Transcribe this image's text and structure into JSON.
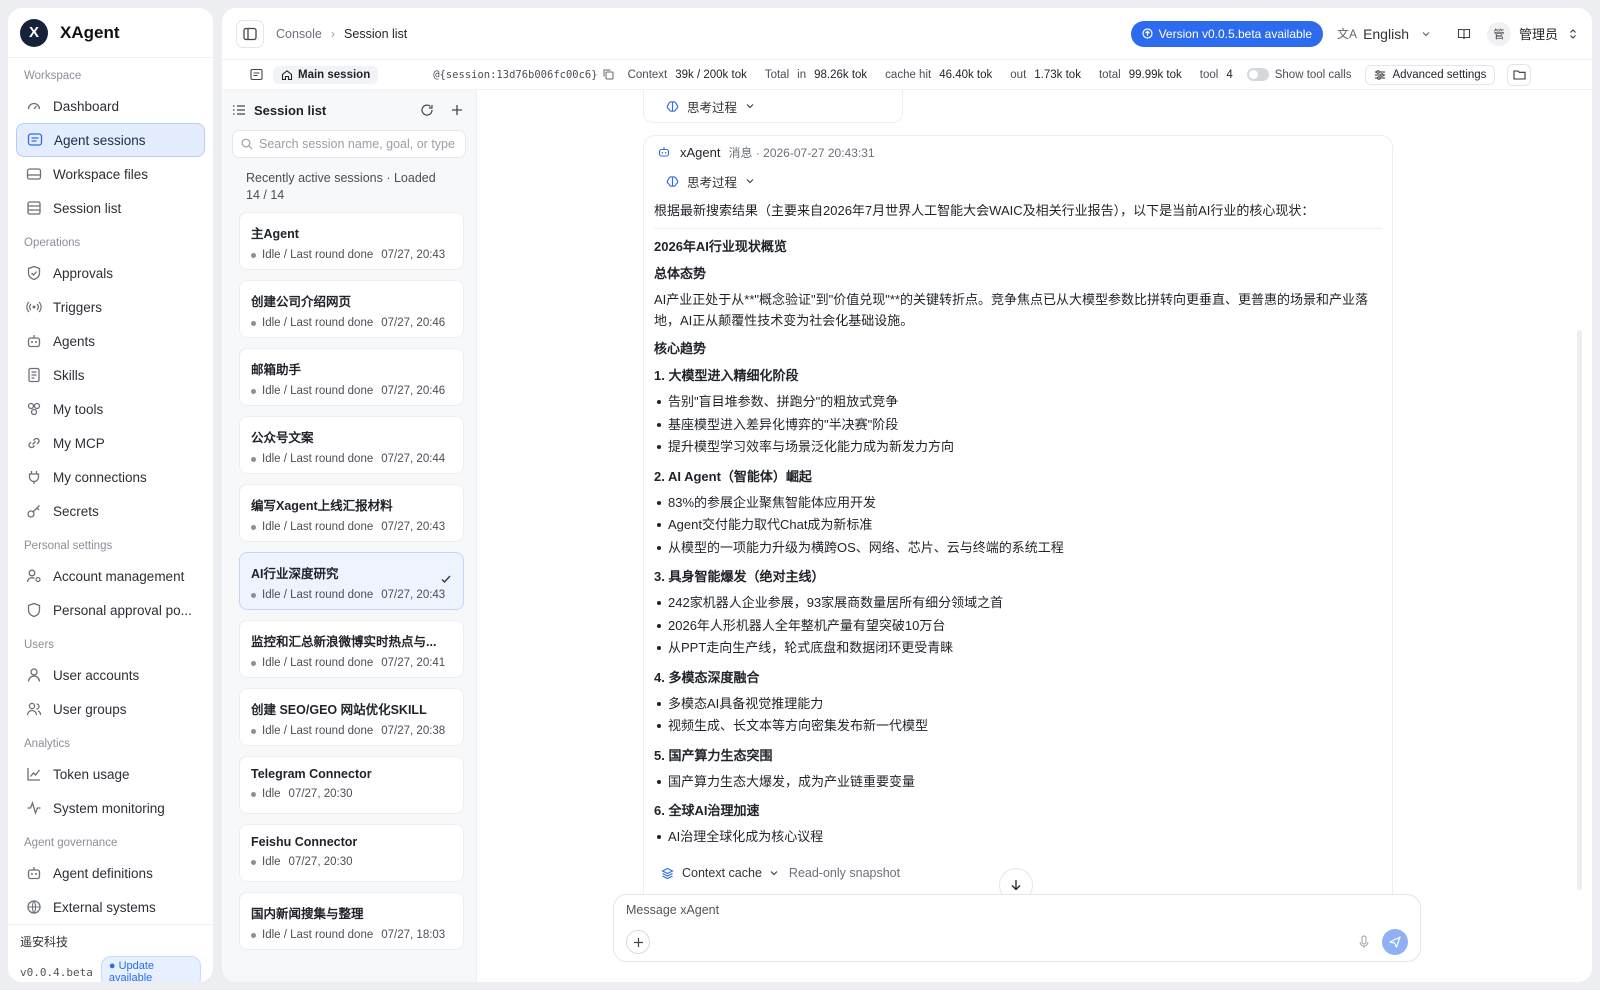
{
  "app": {
    "name": "XAgent",
    "logo_letter": "X"
  },
  "sidebar": {
    "sections": [
      {
        "title": "Workspace",
        "items": [
          {
            "label": "Dashboard",
            "icon": "gauge-icon"
          },
          {
            "label": "Agent sessions",
            "icon": "chat-icon",
            "active": true
          },
          {
            "label": "Workspace files",
            "icon": "drive-icon"
          },
          {
            "label": "Session list",
            "icon": "table-icon"
          }
        ]
      },
      {
        "title": "Operations",
        "items": [
          {
            "label": "Approvals",
            "icon": "shield-check-icon"
          },
          {
            "label": "Triggers",
            "icon": "radio-icon"
          },
          {
            "label": "Agents",
            "icon": "robot-icon"
          },
          {
            "label": "Skills",
            "icon": "book-icon"
          },
          {
            "label": "My tools",
            "icon": "tools-icon"
          },
          {
            "label": "My MCP",
            "icon": "link-icon"
          },
          {
            "label": "My connections",
            "icon": "plug-icon"
          },
          {
            "label": "Secrets",
            "icon": "key-icon"
          }
        ]
      },
      {
        "title": "Personal settings",
        "items": [
          {
            "label": "Account management",
            "icon": "user-cog-icon"
          },
          {
            "label": "Personal approval po...",
            "icon": "shield-icon"
          }
        ]
      },
      {
        "title": "Users",
        "items": [
          {
            "label": "User accounts",
            "icon": "user-icon"
          },
          {
            "label": "User groups",
            "icon": "users-icon"
          }
        ]
      },
      {
        "title": "Analytics",
        "items": [
          {
            "label": "Token usage",
            "icon": "chart-line-icon"
          },
          {
            "label": "System monitoring",
            "icon": "activity-icon"
          }
        ]
      },
      {
        "title": "Agent governance",
        "items": [
          {
            "label": "Agent definitions",
            "icon": "robot-icon"
          },
          {
            "label": "External systems",
            "icon": "globe-icon"
          }
        ]
      }
    ],
    "footer": {
      "org": "遥安科技",
      "version": "v0.0.4.beta",
      "update": "Update available"
    }
  },
  "topbar": {
    "breadcrumb": [
      "Console",
      "Session list"
    ],
    "version_badge": "Version v0.0.5.beta available",
    "language": "English",
    "user": "管理员",
    "user_avatar": "管"
  },
  "infobar": {
    "main_session": "Main session",
    "session_id": "@{session:13d76b006fc00c6}",
    "context_label": "Context",
    "context_value": "39k / 200k tok",
    "total_label": "Total",
    "in_label": "in",
    "in_value": "98.26k tok",
    "cache_label": "cache hit",
    "cache_value": "46.40k tok",
    "out_label": "out",
    "out_value": "1.73k tok",
    "total2_label": "total",
    "total2_value": "99.99k tok",
    "tool_label": "tool",
    "tool_value": "4",
    "show_tool_calls": "Show tool calls",
    "advanced": "Advanced settings"
  },
  "session_list": {
    "title": "Session list",
    "search_placeholder": "Search session name, goal, or type",
    "recent_text": "Recently active sessions · Loaded 14 / 14",
    "sessions": [
      {
        "name": "主Agent",
        "status": "Idle / Last round done",
        "time": "07/27, 20:43"
      },
      {
        "name": "创建公司介绍网页",
        "status": "Idle / Last round done",
        "time": "07/27, 20:46"
      },
      {
        "name": "邮箱助手",
        "status": "Idle / Last round done",
        "time": "07/27, 20:46"
      },
      {
        "name": "公众号文案",
        "status": "Idle / Last round done",
        "time": "07/27, 20:44"
      },
      {
        "name": "编写Xagent上线汇报材料",
        "status": "Idle / Last round done",
        "time": "07/27, 20:43"
      },
      {
        "name": "AI行业深度研究",
        "status": "Idle / Last round done",
        "time": "07/27, 20:43",
        "selected": true
      },
      {
        "name": "监控和汇总新浪微博实时热点与...",
        "status": "Idle / Last round done",
        "time": "07/27, 20:41"
      },
      {
        "name": "创建 SEO/GEO 网站优化SKILL",
        "status": "Idle / Last round done",
        "time": "07/27, 20:38"
      },
      {
        "name": "Telegram Connector",
        "status": "Idle",
        "time": "07/27, 20:30"
      },
      {
        "name": "Feishu Connector",
        "status": "Idle",
        "time": "07/27, 20:30"
      },
      {
        "name": "国内新闻搜集与整理",
        "status": "Idle / Last round done",
        "time": "07/27, 18:03"
      }
    ]
  },
  "chat": {
    "thinking_label": "思考过程",
    "message": {
      "sender": "xAgent",
      "meta": "消息 · 2026-07-27 20:43:31",
      "intro": "根据最新搜索结果（主要来自2026年7月世界人工智能大会WAIC及相关行业报告），以下是当前AI行业的核心现状：",
      "title": "2026年AI行业现状概览",
      "overall_h": "总体态势",
      "overall_p": "AI产业正处于从**\"概念验证\"到\"价值兑现\"**的关键转折点。竞争焦点已从大模型参数比拼转向更垂直、更普惠的场景和产业落地，AI正从颠覆性技术变为社会化基础设施。",
      "trends_h": "核心趋势",
      "sections": [
        {
          "h": "1. 大模型进入精细化阶段",
          "items": [
            "告别\"盲目堆参数、拼跑分\"的粗放式竞争",
            "基座模型进入差异化博弈的\"半决赛\"阶段",
            "提升模型学习效率与场景泛化能力成为新发力方向"
          ]
        },
        {
          "h": "2. AI Agent（智能体）崛起",
          "items": [
            "83%的参展企业聚焦智能体应用开发",
            "Agent交付能力取代Chat成为新标准",
            "从模型的一项能力升级为横跨OS、网络、芯片、云与终端的系统工程"
          ]
        },
        {
          "h": "3. 具身智能爆发（绝对主线）",
          "items": [
            "242家机器人企业参展，93家展商数量居所有细分领域之首",
            "2026年人形机器人全年整机产量有望突破10万台",
            "从PPT走向生产线，轮式底盘和数据闭环更受青睐"
          ]
        },
        {
          "h": "4. 多模态深度融合",
          "items": [
            "多模态AI具备视觉推理能力",
            "视频生成、长文本等方向密集发布新一代模型"
          ]
        },
        {
          "h": "5. 国产算力生态突围",
          "items": [
            "国产算力生态大爆发，成为产业链重要变量"
          ]
        },
        {
          "h": "6. 全球AI治理加速",
          "items": [
            "AI治理全球化成为核心议程"
          ]
        }
      ]
    },
    "context_cache": "Context cache",
    "readonly": "Read-only snapshot",
    "composer_placeholder": "Message xAgent"
  },
  "colors": {
    "accent": "#2c6bed",
    "active_bg": "#e4edfd",
    "send_btn": "#8fb0f3"
  }
}
